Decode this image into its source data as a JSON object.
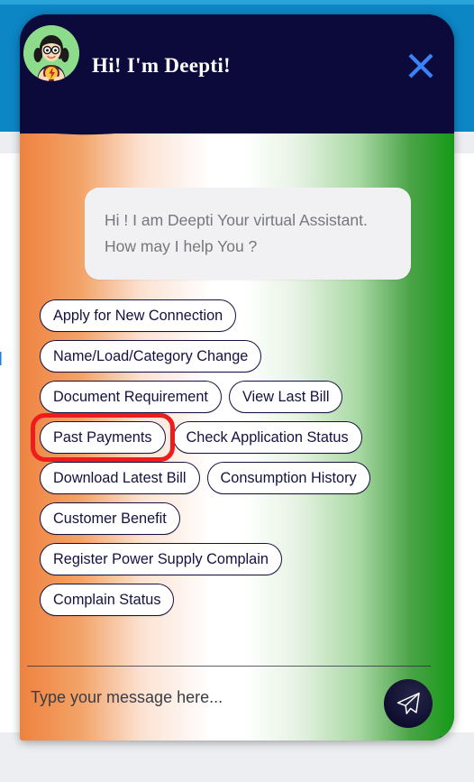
{
  "background": {
    "partial_link_text": "al",
    "topbar_color": "#0d86c6",
    "sheet_color": "#ffffff"
  },
  "widget": {
    "panel_color": "#0b0a3a",
    "accent_blue": "#3b82f6",
    "highlight_color": "#ee1c1c",
    "gradient": [
      "#ee8240",
      "#ffffff",
      "#159a15"
    ],
    "header": {
      "title": "Hi! I'm Deepti!",
      "avatar_name": "deepti-avatar-icon",
      "close_icon": "close-icon"
    },
    "conversation": {
      "bot_message": "Hi ! I am Deepti Your virtual Assistant. How may I help You ?",
      "bot_message_line1": "Hi ! I am Deepti Your virtual Assistant.",
      "bot_message_line2": "How may I help You ?"
    },
    "quick_replies": [
      {
        "label": "Apply for New Connection",
        "highlighted": false
      },
      {
        "label": "Name/Load/Category Change",
        "highlighted": false
      },
      {
        "label": "Document Requirement",
        "highlighted": false
      },
      {
        "label": "View Last Bill",
        "highlighted": false
      },
      {
        "label": "Past Payments",
        "highlighted": true
      },
      {
        "label": "Check Application Status",
        "highlighted": false
      },
      {
        "label": "Download Latest Bill",
        "highlighted": false
      },
      {
        "label": "Consumption History",
        "highlighted": false
      },
      {
        "label": "Customer Benefit",
        "highlighted": false
      },
      {
        "label": "Register Power Supply Complain",
        "highlighted": false
      },
      {
        "label": "Complain Status",
        "highlighted": false
      }
    ],
    "composer": {
      "placeholder": "Type your message here...",
      "value": "",
      "send_icon": "send-paper-plane-icon"
    }
  }
}
